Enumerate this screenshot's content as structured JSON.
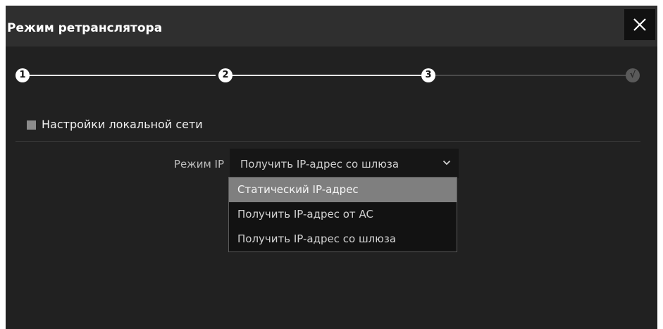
{
  "dialog": {
    "title": "Режим ретранслятора",
    "close_icon": "close-icon"
  },
  "stepper": {
    "steps": [
      {
        "label": "1",
        "state": "done"
      },
      {
        "label": "2",
        "state": "done"
      },
      {
        "label": "3",
        "state": "current"
      },
      {
        "label": "√",
        "state": "pending"
      }
    ]
  },
  "section": {
    "title": "Настройки локальной сети"
  },
  "ip_mode": {
    "label": "Режим IP",
    "selected": "Получить IP-адрес со шлюза",
    "options": [
      "Статический IP-адрес",
      "Получить IP-адрес от AC",
      "Получить IP-адрес со шлюза"
    ],
    "hovered_index": 0
  },
  "colors": {
    "background": "#212121",
    "titlebar": "#2f2f2f",
    "highlight": "#7f7f7f"
  }
}
